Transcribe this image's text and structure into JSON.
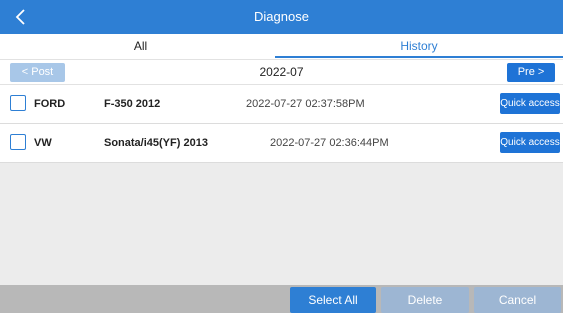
{
  "header": {
    "title": "Diagnose",
    "back_icon": "chevron-left-icon"
  },
  "tabs": [
    {
      "label": "All",
      "active": false
    },
    {
      "label": "History",
      "active": true
    }
  ],
  "date_nav": {
    "prev_label": "< Post",
    "month": "2022-07",
    "next_label": "Pre >"
  },
  "records": [
    {
      "make": "FORD",
      "model": "F-350  2012",
      "timestamp": "2022-07-27 02:37:58PM",
      "action_label": "Quick access",
      "checked": false
    },
    {
      "make": "VW",
      "model": "Sonata/i45(YF)  2013",
      "timestamp": "2022-07-27 02:36:44PM",
      "action_label": "Quick access",
      "checked": false
    }
  ],
  "footer": {
    "select_all_label": "Select All",
    "delete_label": "Delete",
    "cancel_label": "Cancel"
  },
  "colors": {
    "accent": "#2e7fd4",
    "button_blue": "#1e73d6",
    "disabled_blue": "#9db6d3",
    "footer_gray": "#b8b8b8"
  }
}
